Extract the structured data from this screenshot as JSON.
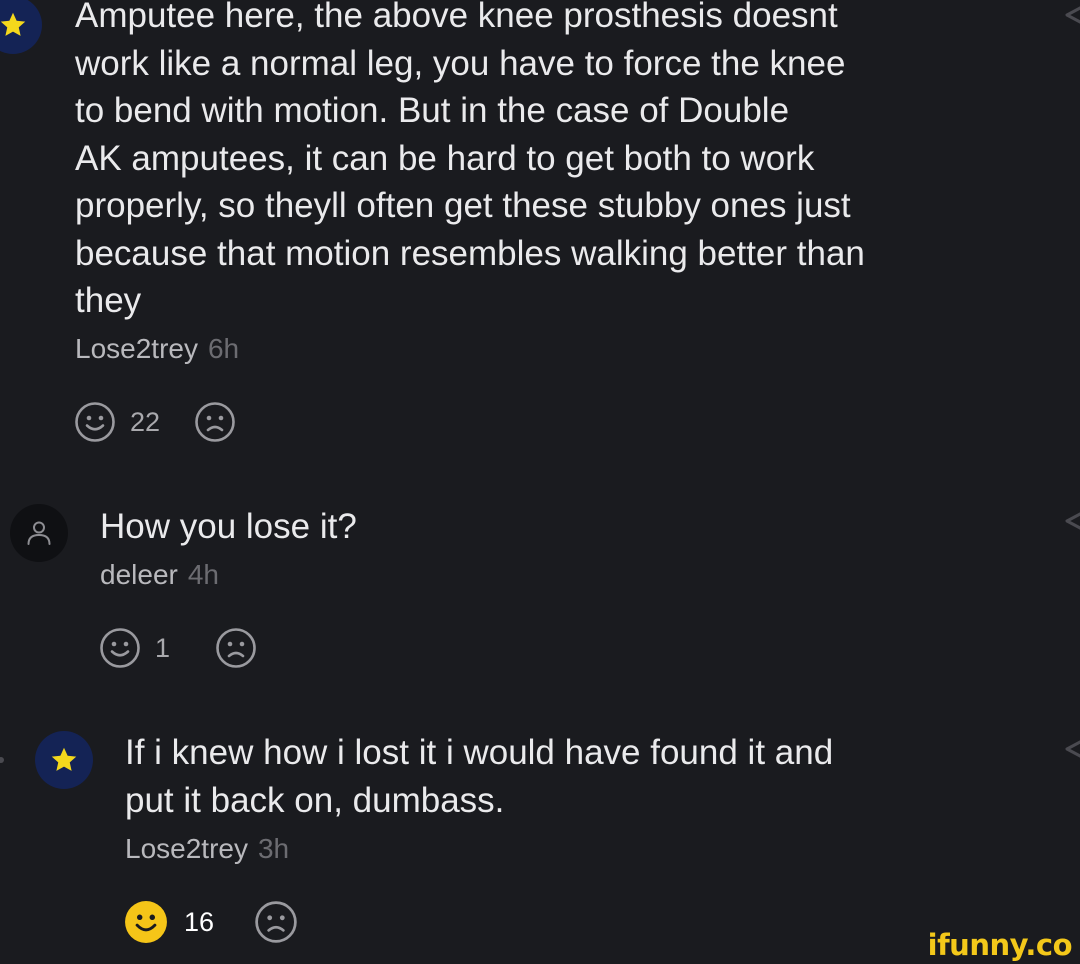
{
  "comments": [
    {
      "avatar_icon": "star-icon",
      "text": "Amputee here, the above knee prosthesis doesnt\nwork like a normal leg, you have to force the knee\nto bend with motion. But in the case of Double\nAK amputees, it can be hard to get both to work\nproperly, so theyll often get these stubby ones just\nbecause that motion resembles walking better than\nthey",
      "author": "Lose2trey",
      "time": "6h",
      "likes": "22",
      "liked": false
    },
    {
      "avatar_icon": "user-icon",
      "text": "How you lose it?",
      "author": "deleer",
      "time": "4h",
      "likes": "1",
      "liked": false
    },
    {
      "avatar_icon": "star-icon",
      "text": "If i knew how i lost it i would have found it and\nput it back on, dumbass.",
      "author": "Lose2trey",
      "time": "3h",
      "likes": "16",
      "liked": true
    }
  ],
  "watermark": "ifunny.co",
  "colors": {
    "background": "#1a1b1f",
    "star_avatar_bg": "#142355",
    "star": "#f4d81c",
    "liked_smile": "#f5c518",
    "watermark": "#f3c81a"
  }
}
